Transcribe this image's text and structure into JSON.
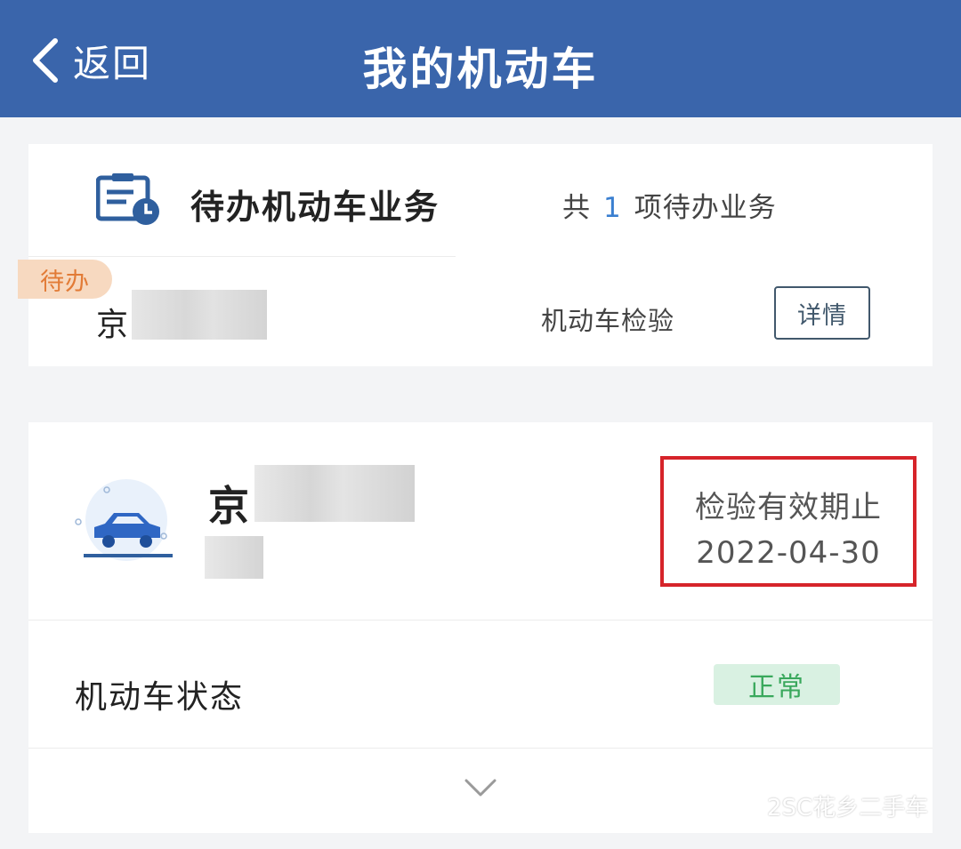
{
  "header": {
    "back_label": "返回",
    "title": "我的机动车",
    "background_color": "#3a65ab"
  },
  "todo_card": {
    "icon": "clipboard-clock-icon",
    "title": "待办机动车业务",
    "summary_prefix": "共",
    "summary_count": "1",
    "summary_suffix": "项待办业务",
    "badge": "待办",
    "plate_prefix": "京",
    "item_type": "机动车检验",
    "detail_button": "详情"
  },
  "vehicle_card": {
    "icon": "car-icon",
    "plate_prefix": "京",
    "inspection_label": "检验有效期止",
    "inspection_date": "2022-04-30",
    "highlight_color": "#d6242a",
    "status_label": "机动车状态",
    "status_value": "正常",
    "expand_icon": "chevron-down-icon"
  },
  "watermark": {
    "icon": "wechat-icon",
    "text": "2SC花乡二手车"
  }
}
